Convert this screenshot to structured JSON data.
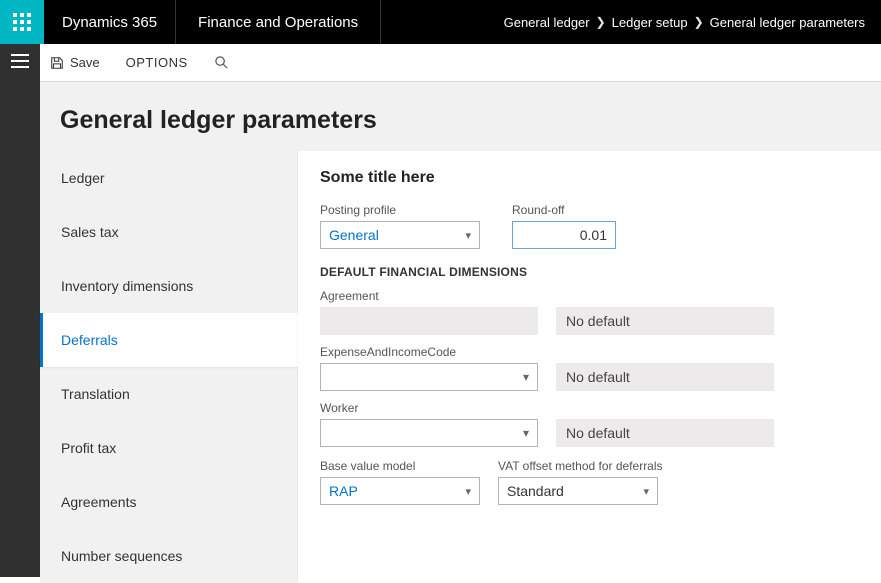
{
  "header": {
    "brand": "Dynamics 365",
    "module": "Finance and Operations",
    "breadcrumb": [
      "General ledger",
      "Ledger setup",
      "General ledger parameters"
    ]
  },
  "toolbar": {
    "save_label": "Save",
    "options_label": "OPTIONS"
  },
  "page": {
    "title": "General ledger parameters"
  },
  "tabs": [
    {
      "label": "Ledger"
    },
    {
      "label": "Sales tax"
    },
    {
      "label": "Inventory dimensions"
    },
    {
      "label": "Deferrals",
      "active": true
    },
    {
      "label": "Translation"
    },
    {
      "label": "Profit tax"
    },
    {
      "label": "Agreements"
    },
    {
      "label": "Number sequences"
    }
  ],
  "form": {
    "section_title": "Some title here",
    "posting_profile": {
      "label": "Posting profile",
      "value": "General"
    },
    "round_off": {
      "label": "Round-off",
      "value": "0.01"
    },
    "dims_header": "DEFAULT FINANCIAL DIMENSIONS",
    "dims": [
      {
        "label": "Agreement",
        "value": "",
        "default": "No default",
        "readonly": true
      },
      {
        "label": "ExpenseAndIncomeCode",
        "value": "",
        "default": "No default",
        "readonly": false
      },
      {
        "label": "Worker",
        "value": "",
        "default": "No default",
        "readonly": false
      }
    ],
    "base_value_model": {
      "label": "Base value model",
      "value": "RAP"
    },
    "vat_offset": {
      "label": "VAT offset method for deferrals",
      "value": "Standard"
    }
  }
}
